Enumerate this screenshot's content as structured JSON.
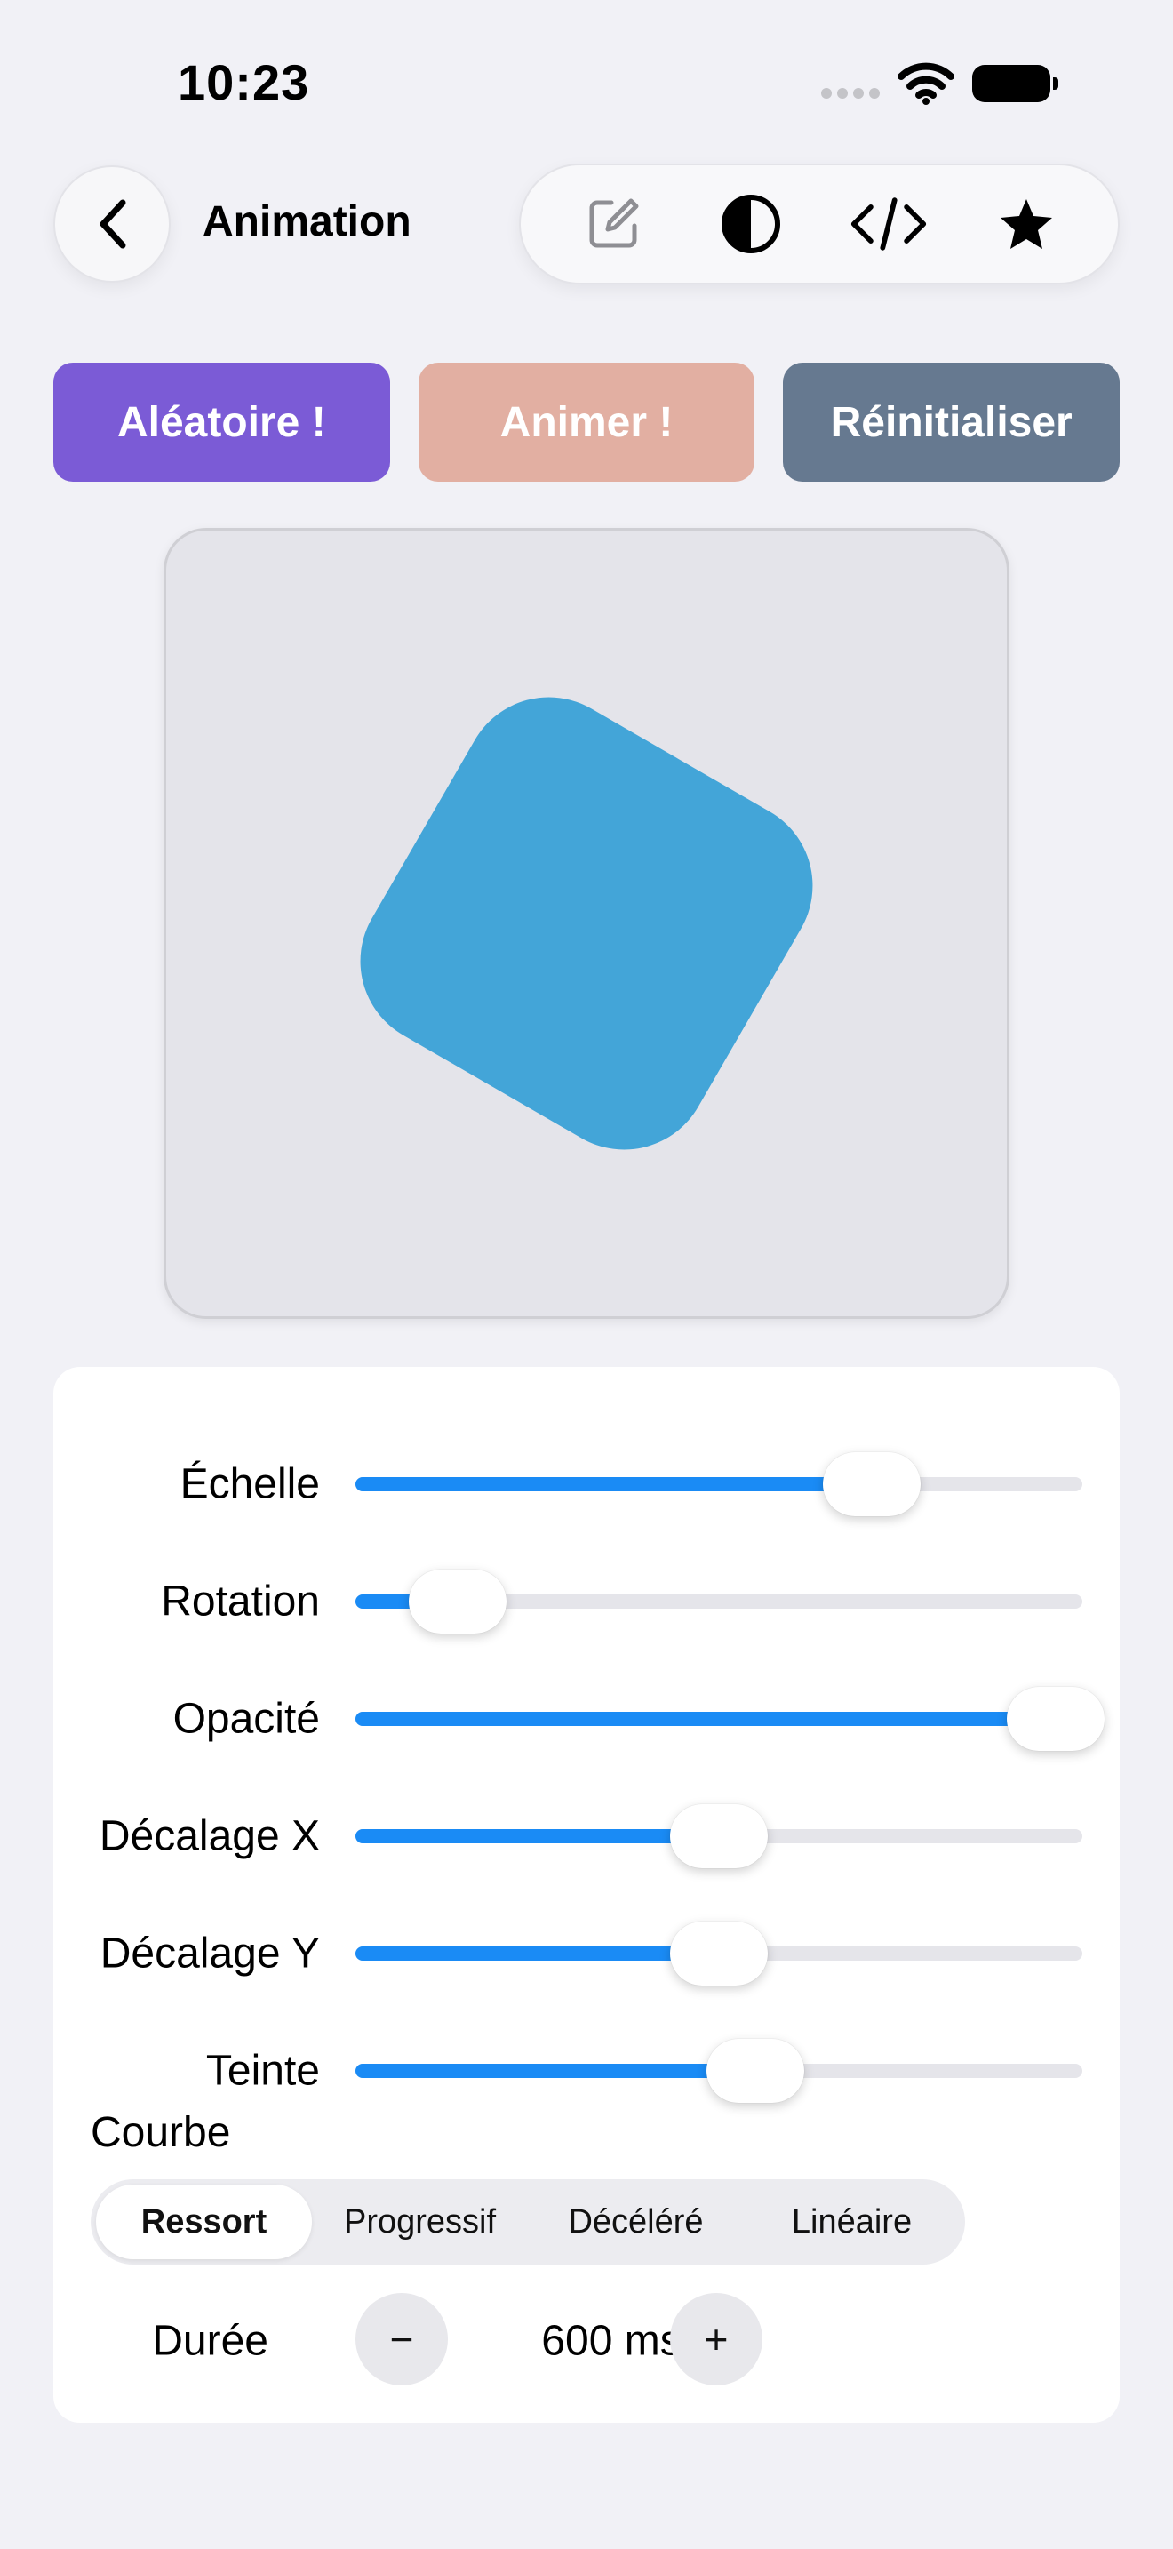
{
  "status_bar": {
    "time": "10:23"
  },
  "nav": {
    "title": "Animation"
  },
  "actions": {
    "random_label": "Aléatoire !",
    "animate_label": "Animer !",
    "reset_label": "Réinitialiser"
  },
  "preview": {
    "shape_color": "#43a5d8",
    "rotation_deg": 30
  },
  "controls": {
    "sliders": [
      {
        "label": "Échelle",
        "value": 0.71
      },
      {
        "label": "Rotation",
        "value": 0.14
      },
      {
        "label": "Opacité",
        "value": 1.0
      },
      {
        "label": "Décalage X",
        "value": 0.5
      },
      {
        "label": "Décalage Y",
        "value": 0.5
      },
      {
        "label": "Teinte",
        "value": 0.55
      }
    ],
    "curve_label": "Courbe",
    "curve_options": [
      "Ressort",
      "Progressif",
      "Décéléré",
      "Linéaire"
    ],
    "curve_selected": "Ressort",
    "duration_label": "Durée",
    "duration_value": "600 ms",
    "decrement_label": "−",
    "increment_label": "+"
  },
  "colors": {
    "accent": "#1a8bf5",
    "random_button": "#7b5bd6",
    "animate_button": "#e2afa2",
    "reset_button": "#667990"
  }
}
